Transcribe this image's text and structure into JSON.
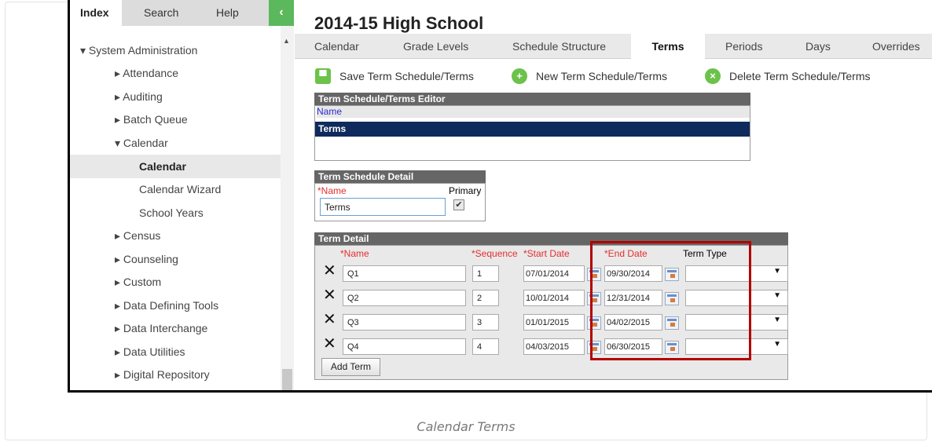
{
  "sidebar": {
    "tabs": [
      "Index",
      "Search",
      "Help"
    ],
    "collapse_icon": "‹",
    "tree": [
      {
        "label": "▾ System Administration",
        "level": 0
      },
      {
        "label": "▸ Attendance",
        "level": 1
      },
      {
        "label": "▸ Auditing",
        "level": 1
      },
      {
        "label": "▸ Batch Queue",
        "level": 1
      },
      {
        "label": "▾ Calendar",
        "level": 1
      },
      {
        "label": "Calendar",
        "level": 2,
        "selected": true
      },
      {
        "label": "Calendar Wizard",
        "level": 2
      },
      {
        "label": "School Years",
        "level": 2
      },
      {
        "label": "▸ Census",
        "level": 1
      },
      {
        "label": "▸ Counseling",
        "level": 1
      },
      {
        "label": "▸ Custom",
        "level": 1
      },
      {
        "label": "▸ Data Defining Tools",
        "level": 1
      },
      {
        "label": "▸ Data Interchange",
        "level": 1
      },
      {
        "label": "▸ Data Utilities",
        "level": 1
      },
      {
        "label": "▸ Digital Repository",
        "level": 1
      }
    ]
  },
  "main": {
    "title": "2014-15 High School",
    "nav_tabs": [
      "Calendar",
      "Grade Levels",
      "Schedule Structure",
      "Terms",
      "Periods",
      "Days",
      "Overrides"
    ],
    "active_tab": "Terms",
    "actions": {
      "save": "Save Term Schedule/Terms",
      "new": "New Term Schedule/Terms",
      "delete": "Delete Term Schedule/Terms"
    },
    "editor": {
      "header": "Term Schedule/Terms Editor",
      "column": "Name",
      "selected_row": "Terms"
    },
    "schedule_detail": {
      "header": "Term Schedule Detail",
      "name_label": "*Name",
      "primary_label": "Primary",
      "name_value": "Terms",
      "primary_checked": true
    },
    "term_detail": {
      "header": "Term Detail",
      "columns": {
        "name": "*Name",
        "sequence": "*Sequence",
        "start": "*Start Date",
        "end": "*End Date",
        "type": "Term Type"
      },
      "rows": [
        {
          "name": "Q1",
          "sequence": "1",
          "start": "07/01/2014",
          "end": "09/30/2014",
          "type": ""
        },
        {
          "name": "Q2",
          "sequence": "2",
          "start": "10/01/2014",
          "end": "12/31/2014",
          "type": ""
        },
        {
          "name": "Q3",
          "sequence": "3",
          "start": "01/01/2015",
          "end": "04/02/2015",
          "type": ""
        },
        {
          "name": "Q4",
          "sequence": "4",
          "start": "04/03/2015",
          "end": "06/30/2015",
          "type": ""
        }
      ],
      "add_button": "Add Term"
    }
  },
  "caption": "Calendar Terms",
  "colors": {
    "accent_green": "#5cb85c",
    "header_gray": "#666666",
    "selected_row": "#0f2a5c",
    "required_red": "#e52e2e",
    "highlight_red": "#b30000"
  }
}
